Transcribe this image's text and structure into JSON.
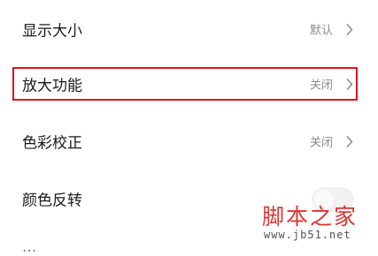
{
  "settings": [
    {
      "label": "显示大小",
      "value": "默认"
    },
    {
      "label": "放大功能",
      "value": "关闭"
    },
    {
      "label": "色彩校正",
      "value": "关闭"
    },
    {
      "label": "颜色反转"
    }
  ],
  "cutoff_row_label": "...",
  "icons": {
    "chevron": "chevron-right-icon"
  },
  "highlight": {
    "color": "#e0141e"
  },
  "watermark": {
    "title": "脚本之家",
    "url": "www.jb51.net"
  }
}
